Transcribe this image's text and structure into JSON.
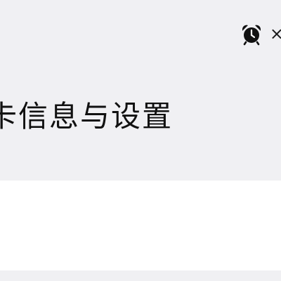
{
  "header": {
    "title": "卡信息与设置",
    "status_icons": [
      "alarm-clock-icon",
      "close-icon"
    ],
    "close_glyph": "×"
  },
  "colors": {
    "background": "#f0f0f3",
    "card": "#ffffff",
    "text": "#111111"
  }
}
